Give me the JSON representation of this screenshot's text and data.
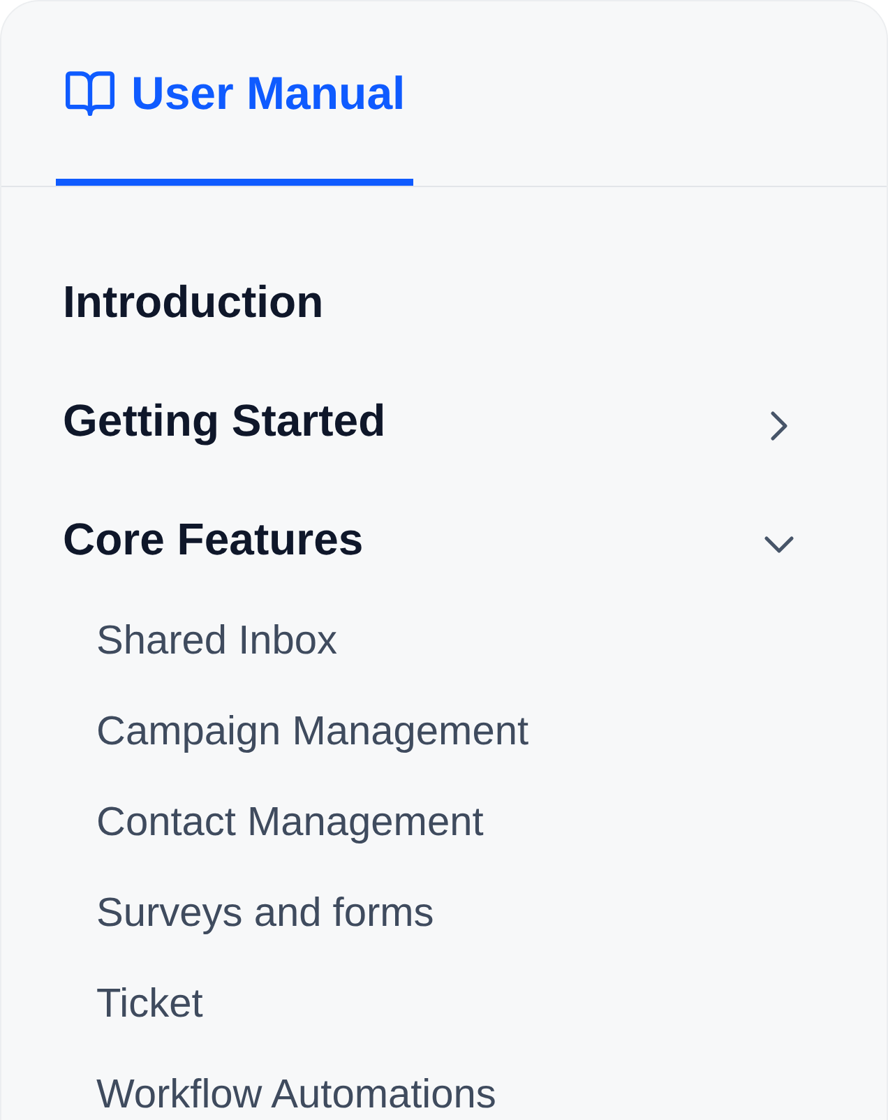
{
  "header": {
    "tabs": [
      {
        "label": "User Manual",
        "selected": true
      }
    ]
  },
  "nav": {
    "items": [
      {
        "kind": "link",
        "label": "Introduction"
      },
      {
        "kind": "section",
        "label": "Getting Started",
        "expanded": false
      },
      {
        "kind": "section",
        "label": "Core Features",
        "expanded": true,
        "children": [
          {
            "label": "Shared Inbox"
          },
          {
            "label": "Campaign Management"
          },
          {
            "label": "Contact Management"
          },
          {
            "label": "Surveys and forms"
          },
          {
            "label": "Ticket"
          },
          {
            "label": "Workflow Automations"
          }
        ]
      }
    ]
  }
}
